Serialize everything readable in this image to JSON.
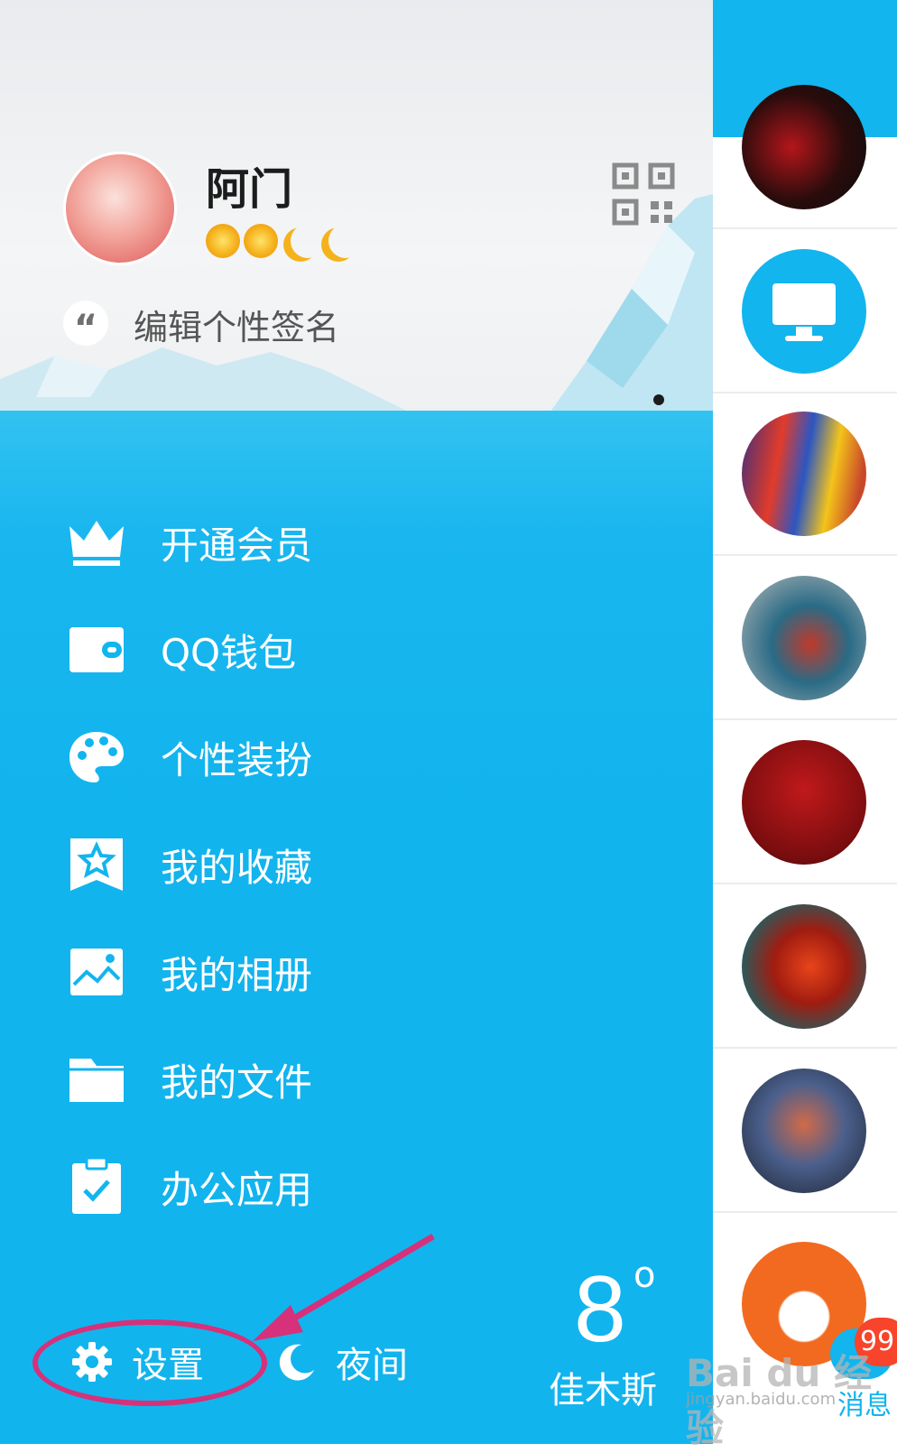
{
  "profile": {
    "nickname": "阿门",
    "signature": "编辑个性签名",
    "quote_glyph": "“"
  },
  "menu": {
    "items": [
      {
        "label": "开通会员",
        "icon": "crown-icon"
      },
      {
        "label": "QQ钱包",
        "icon": "wallet-icon"
      },
      {
        "label": "个性装扮",
        "icon": "palette-icon"
      },
      {
        "label": "我的收藏",
        "icon": "bookmark-star-icon"
      },
      {
        "label": "我的相册",
        "icon": "image-icon"
      },
      {
        "label": "我的文件",
        "icon": "folder-icon"
      },
      {
        "label": "办公应用",
        "icon": "clipboard-check-icon"
      }
    ]
  },
  "bottom": {
    "settings_label": "设置",
    "night_label": "夜间"
  },
  "weather": {
    "temperature": "8",
    "degree_symbol": "o",
    "city": "佳木斯"
  },
  "tabbar": {
    "messages_label": "消息",
    "badge": "99"
  },
  "watermark": {
    "brand": "Bai du 经验",
    "url": "jingyan.baidu.com"
  },
  "colors": {
    "accent": "#12b5ee",
    "annotation": "#d6317a",
    "badge": "#f7442a"
  }
}
